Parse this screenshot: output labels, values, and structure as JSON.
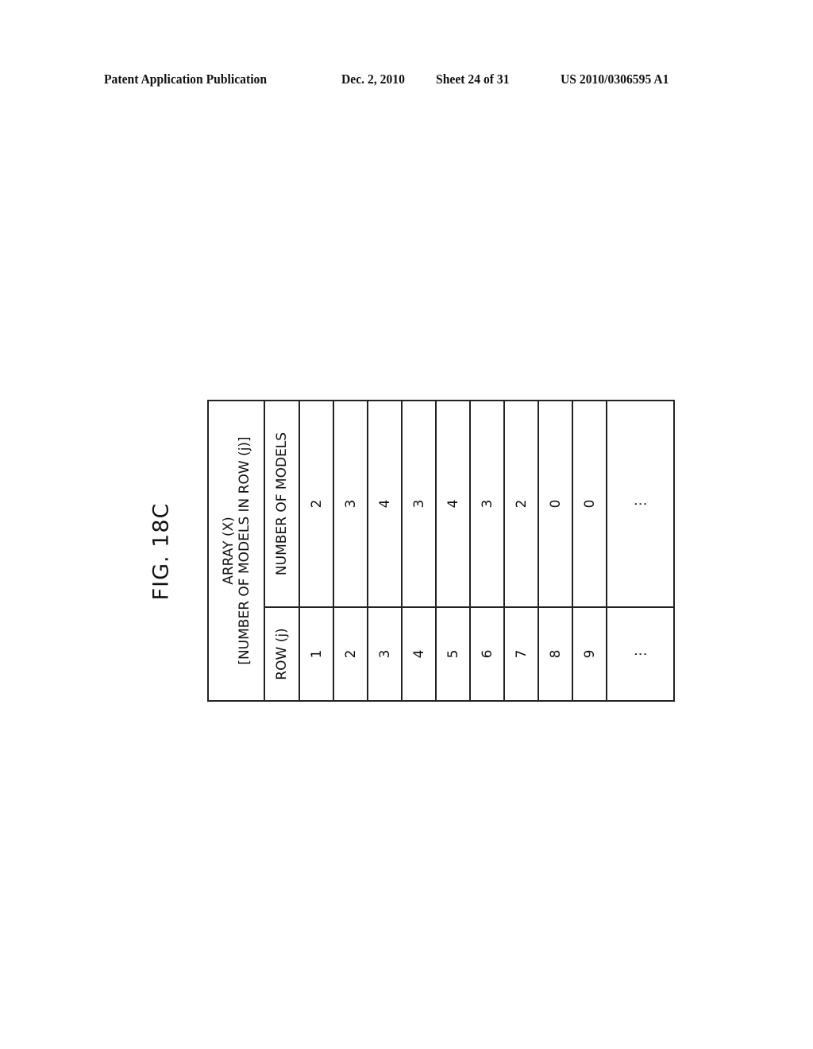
{
  "header": {
    "publication": "Patent Application Publication",
    "date": "Dec. 2, 2010",
    "sheet": "Sheet 24 of 31",
    "number": "US 2010/0306595 A1"
  },
  "figure": {
    "title": "FIG. 18C",
    "table": {
      "title_line1": "ARRAY (X)",
      "title_line2": "[NUMBER OF MODELS IN ROW (j)]",
      "columns": [
        "ROW (j)",
        "NUMBER OF MODELS"
      ],
      "rows": [
        {
          "row": "1",
          "models": "2"
        },
        {
          "row": "2",
          "models": "3"
        },
        {
          "row": "3",
          "models": "4"
        },
        {
          "row": "4",
          "models": "3"
        },
        {
          "row": "5",
          "models": "4"
        },
        {
          "row": "6",
          "models": "3"
        },
        {
          "row": "7",
          "models": "2"
        },
        {
          "row": "8",
          "models": "0"
        },
        {
          "row": "9",
          "models": "0"
        },
        {
          "row": "⋮",
          "models": "⋮"
        }
      ]
    }
  }
}
